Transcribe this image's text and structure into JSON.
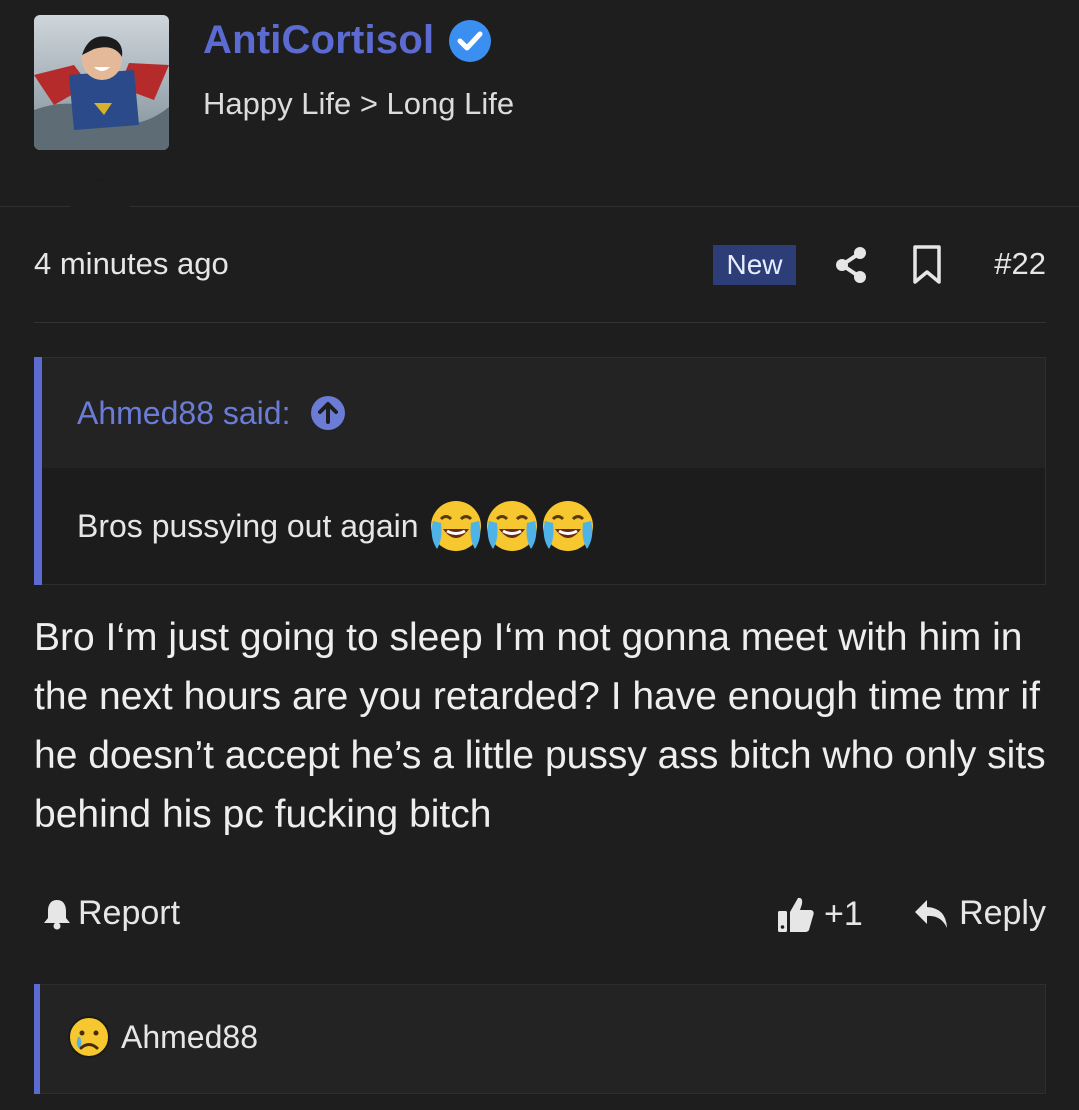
{
  "user": {
    "name": "AntiCortisol",
    "title": "Happy Life > Long Life",
    "verified_icon": "verified-badge-icon",
    "accent_color": "#5b6bd1"
  },
  "post": {
    "timestamp": "4 minutes ago",
    "badge": "New",
    "number": "#22",
    "quote": {
      "author": "Ahmed88 said:",
      "text": "Bros pussying out again",
      "emojis": [
        "loudly-crying-face-emoji",
        "loudly-crying-face-emoji",
        "loudly-crying-face-emoji"
      ]
    },
    "message": "Bro I‘m just going to sleep I‘m not gonna meet with him in the next hours are you retarded? I have enough time tmr if he doesn’t accept he’s a little pussy ass bitch who only sits behind his pc fucking bitch"
  },
  "actions": {
    "report": "Report",
    "like_count": "+1",
    "reply": "Reply"
  },
  "reactions": {
    "user": "Ahmed88",
    "emoji": "crying-face-emoji"
  }
}
